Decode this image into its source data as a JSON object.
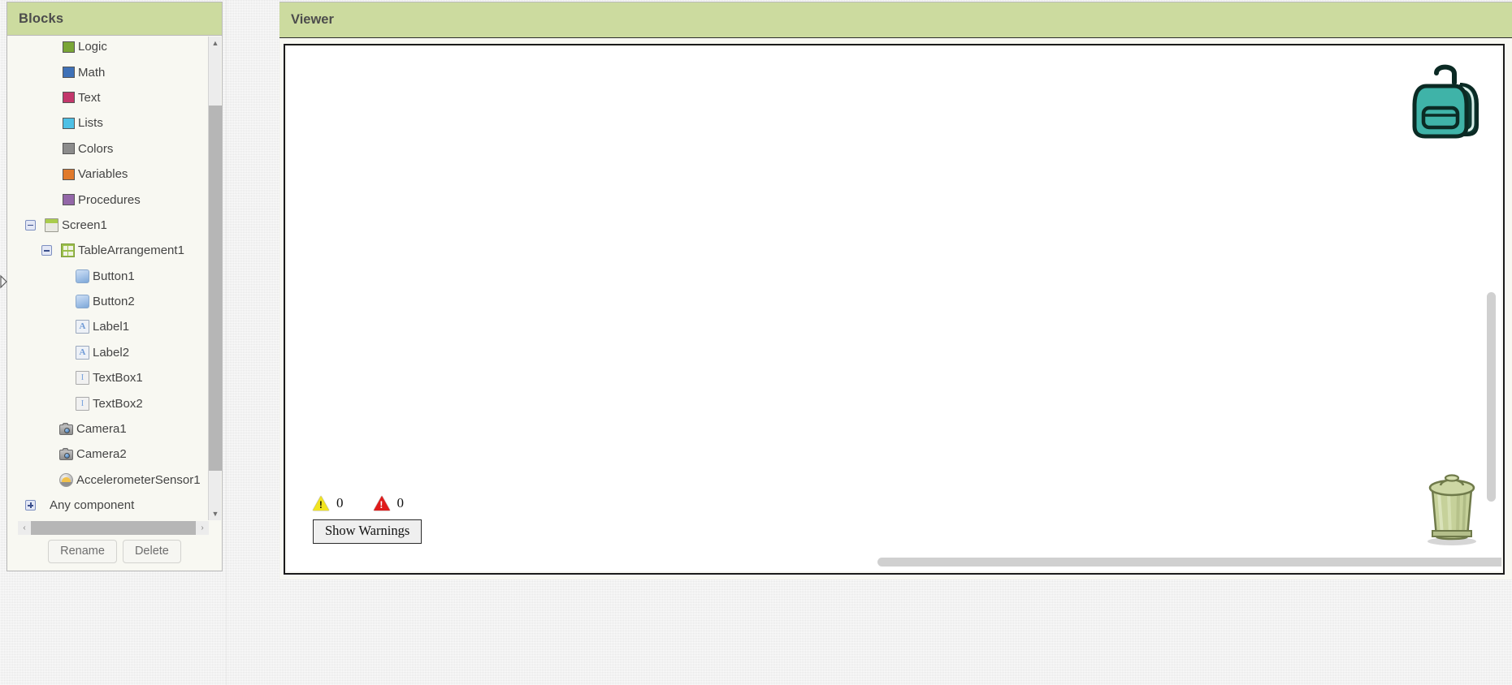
{
  "blocks_panel": {
    "title": "Blocks",
    "builtin_blocks": [
      {
        "label": "Logic",
        "color": "#7aa637",
        "icon": "color-swatch-icon"
      },
      {
        "label": "Math",
        "color": "#3f71b7",
        "icon": "color-swatch-icon"
      },
      {
        "label": "Text",
        "color": "#c3376b",
        "icon": "color-swatch-icon"
      },
      {
        "label": "Lists",
        "color": "#4ec0e5",
        "icon": "color-swatch-icon"
      },
      {
        "label": "Colors",
        "color": "#8c8c8c",
        "icon": "color-swatch-icon"
      },
      {
        "label": "Variables",
        "color": "#e07a2c",
        "icon": "color-swatch-icon"
      },
      {
        "label": "Procedures",
        "color": "#9367a8",
        "icon": "color-swatch-icon"
      }
    ],
    "tree": [
      {
        "label": "Screen1",
        "icon": "screen-icon",
        "toggle": "minus",
        "depth": 0
      },
      {
        "label": "TableArrangement1",
        "icon": "table-arrangement-icon",
        "toggle": "minus",
        "depth": 1
      },
      {
        "label": "Button1",
        "icon": "button-icon",
        "toggle": "none",
        "depth": 2
      },
      {
        "label": "Button2",
        "icon": "button-icon",
        "toggle": "none",
        "depth": 2
      },
      {
        "label": "Label1",
        "icon": "label-icon",
        "toggle": "none",
        "depth": 2
      },
      {
        "label": "Label2",
        "icon": "label-icon",
        "toggle": "none",
        "depth": 2
      },
      {
        "label": "TextBox1",
        "icon": "textbox-icon",
        "toggle": "none",
        "depth": 2
      },
      {
        "label": "TextBox2",
        "icon": "textbox-icon",
        "toggle": "none",
        "depth": 2
      },
      {
        "label": "Camera1",
        "icon": "camera-icon",
        "toggle": "none",
        "depth": 1
      },
      {
        "label": "Camera2",
        "icon": "camera-icon",
        "toggle": "none",
        "depth": 1
      },
      {
        "label": "AccelerometerSensor1",
        "icon": "accelerometer-icon",
        "toggle": "none",
        "depth": 1
      },
      {
        "label": "Any component",
        "icon": "none",
        "toggle": "plus",
        "depth": 0
      }
    ],
    "buttons": {
      "rename": "Rename",
      "delete": "Delete"
    },
    "scroll_arrows": {
      "up": "▲",
      "down": "▼",
      "left": "‹",
      "right": "›"
    }
  },
  "viewer": {
    "title": "Viewer",
    "warnings": {
      "warning_icon": "warning-triangle-icon",
      "warning_glyph": "!",
      "warning_count": "0",
      "error_icon": "error-triangle-icon",
      "error_glyph": "!",
      "error_count": "0",
      "toggle_button_label": "Show Warnings"
    },
    "backpack_icon": "backpack-icon",
    "trash_icon": "trashcan-icon"
  },
  "colors": {
    "header_green": "#ccdb9f",
    "panel_bg": "#f8f8f2",
    "canvas_bg": "#ffffff",
    "warning_yellow": "#f2e420",
    "error_red": "#e01b1b",
    "backpack_teal": "#3fb3a8",
    "trash_green": "#bcc98f"
  }
}
